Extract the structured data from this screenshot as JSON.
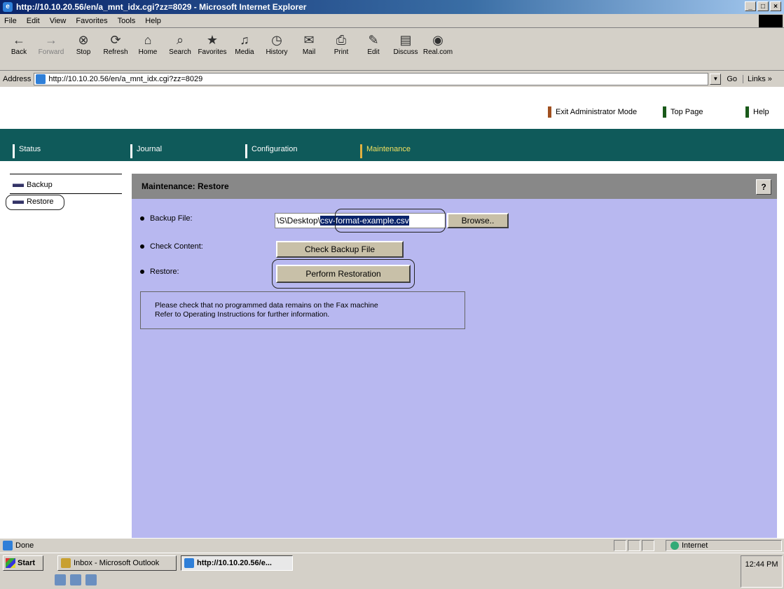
{
  "window": {
    "title": "http://10.10.20.56/en/a_mnt_idx.cgi?zz=8029 - Microsoft Internet Explorer",
    "controls": [
      "_",
      "□",
      "×"
    ]
  },
  "menu": [
    "File",
    "Edit",
    "View",
    "Favorites",
    "Tools",
    "Help"
  ],
  "toolbar": [
    {
      "label": "Back",
      "icon": "←"
    },
    {
      "label": "Forward",
      "icon": "→"
    },
    {
      "label": "Stop",
      "icon": "⊗"
    },
    {
      "label": "Refresh",
      "icon": "⟳"
    },
    {
      "label": "Home",
      "icon": "⌂"
    },
    {
      "label": "Search",
      "icon": "⌕"
    },
    {
      "label": "Favorites",
      "icon": "★"
    },
    {
      "label": "Media",
      "icon": "♫"
    },
    {
      "label": "History",
      "icon": "◷"
    },
    {
      "label": "Mail",
      "icon": "✉"
    },
    {
      "label": "Print",
      "icon": "⎙"
    },
    {
      "label": "Edit",
      "icon": "✎"
    },
    {
      "label": "Discuss",
      "icon": "▤"
    },
    {
      "label": "Real.com",
      "icon": "◉"
    }
  ],
  "address": {
    "label": "Address",
    "url": "http://10.10.20.56/en/a_mnt_idx.cgi?zz=8029",
    "go": "Go",
    "links": "Links »"
  },
  "top_links": {
    "exit": "Exit Administrator Mode",
    "top": "Top Page",
    "help": "Help"
  },
  "tabs": [
    "Status",
    "Journal",
    "Configuration",
    "Maintenance"
  ],
  "sidebar": [
    "Backup",
    "Restore"
  ],
  "content": {
    "heading": "Maintenance: Restore",
    "help_button": "?",
    "backup_file_label": "Backup File:",
    "file_path_prefix": "\\S\\Desktop\\",
    "file_name": "csv-format-example.csv",
    "browse_label": "Browse..",
    "check_content_label": "Check Content:",
    "check_button": "Check Backup File",
    "restore_label": "Restore:",
    "restore_button": "Perform Restoration",
    "notice_line1": "Please check that no programmed data remains on the Fax machine",
    "notice_line2": "Refer to Operating Instructions for further information."
  },
  "status": {
    "text": "Done",
    "zone": "Internet"
  },
  "taskbar": {
    "start": "Start",
    "task1": "Inbox - Microsoft Outlook",
    "task2": "http://10.10.20.56/e...",
    "clock": "12:44 PM"
  }
}
